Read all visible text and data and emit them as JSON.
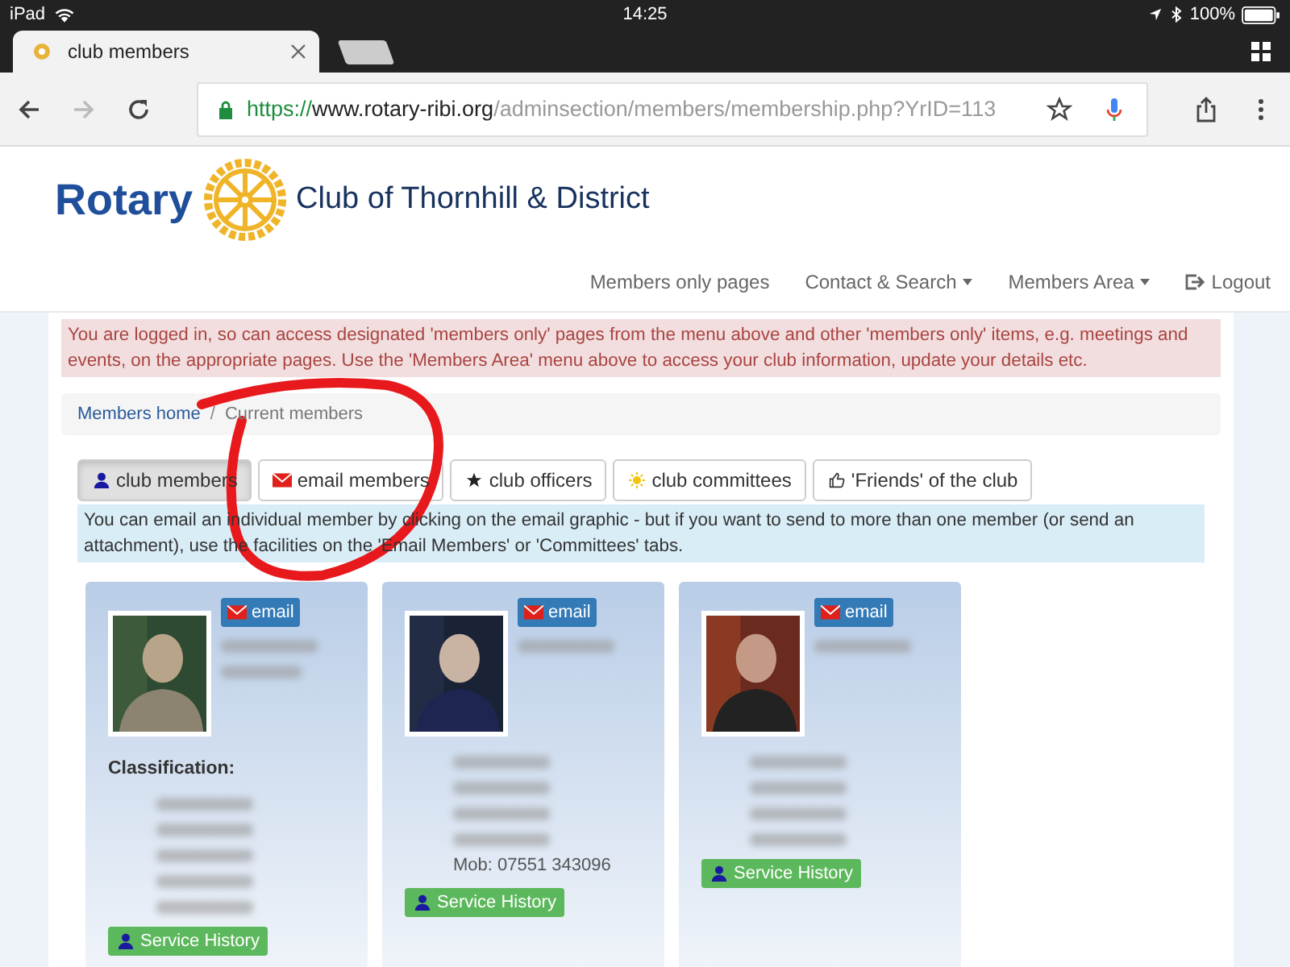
{
  "status_bar": {
    "device": "iPad",
    "time": "14:25",
    "battery": "100%"
  },
  "browser": {
    "tab_title": "club members",
    "url_scheme": "https://",
    "url_host": "www.rotary-ribi.org",
    "url_path": "/adminsection/members/membership.php?YrID=113"
  },
  "header": {
    "logo_text": "Rotary",
    "club_name": "Club of Thornhill & District"
  },
  "nav": [
    {
      "label": "Members only pages",
      "kind": "link"
    },
    {
      "label": "Contact & Search",
      "kind": "dropdown"
    },
    {
      "label": "Members Area",
      "kind": "dropdown"
    },
    {
      "label": "Logout",
      "kind": "logout"
    }
  ],
  "alert": "You are logged in, so can access designated 'members only' pages from the menu above and other 'members only' items, e.g. meetings and events, on the appropriate pages. Use the 'Members Area' menu above to access your club information, update your details etc.",
  "breadcrumb_separator": "/",
  "breadcrumb": [
    {
      "label": "Members home",
      "kind": "link"
    },
    {
      "label": "Current members",
      "kind": "current"
    }
  ],
  "tabs": [
    {
      "label": "club members",
      "kind": "person",
      "selected": true
    },
    {
      "label": "email members",
      "kind": "envelope",
      "selected": false
    },
    {
      "label": "club officers",
      "kind": "star",
      "selected": false
    },
    {
      "label": "club committees",
      "kind": "sun",
      "selected": false
    },
    {
      "label": "'Friends' of the club",
      "kind": "thumb",
      "selected": false
    }
  ],
  "info": "You can email an individual member by clicking on the email graphic - but if you want to send to more than one member (or send an attachment), use the facilities on the 'Email Members' or 'Committees' tabs.",
  "members": [
    {
      "email_button": "email",
      "label": "Classification:",
      "history_button": "Service History"
    },
    {
      "email_button": "email",
      "mob": "Mob: 07551 343096",
      "history_button": "Service History"
    },
    {
      "email_button": "email",
      "history_button": "Service History"
    }
  ]
}
